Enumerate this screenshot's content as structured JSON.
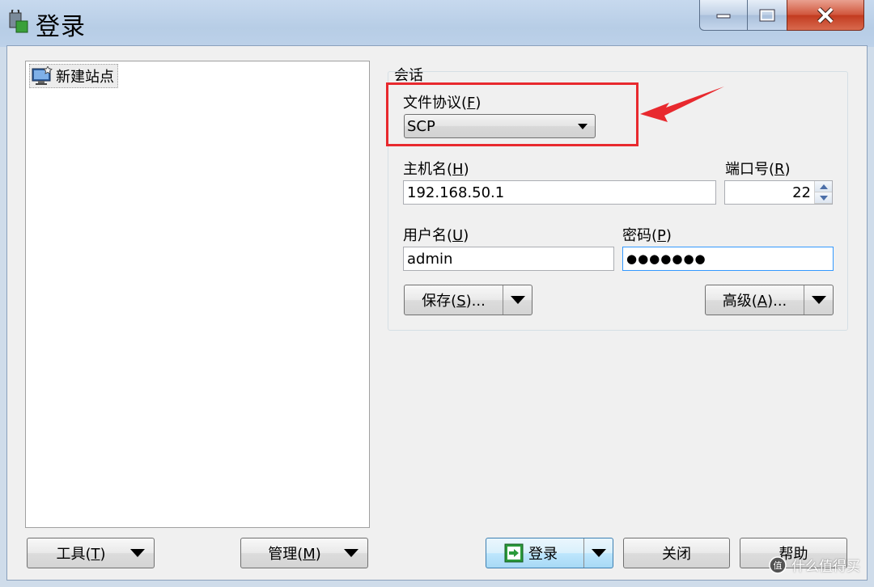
{
  "window": {
    "title": "登录",
    "minimize_icon": "minimize-icon",
    "maximize_icon": "maximize-icon",
    "close_icon": "close-icon"
  },
  "tree": {
    "items": [
      {
        "label": "新建站点",
        "icon": "monitor-new-site-icon"
      }
    ]
  },
  "session": {
    "group_label": "会话",
    "protocol_label": "文件协议",
    "protocol_key": "F",
    "protocol_value": "SCP",
    "host_label": "主机名",
    "host_key": "H",
    "host_value": "192.168.50.1",
    "port_label": "端口号",
    "port_key": "R",
    "port_value": "22",
    "user_label": "用户名",
    "user_key": "U",
    "user_value": "admin",
    "password_label": "密码",
    "password_key": "P",
    "password_value": "●●●●●●●",
    "save_label": "保存",
    "save_key": "S",
    "save_suffix": "...",
    "advanced_label": "高级",
    "advanced_key": "A",
    "advanced_suffix": "..."
  },
  "footer": {
    "tools_label": "工具",
    "tools_key": "T",
    "manage_label": "管理",
    "manage_key": "M",
    "login_label": "登录",
    "close_label": "关闭",
    "help_label": "帮助"
  },
  "annotation": {
    "color": "#e8292e"
  },
  "watermark": {
    "text": "什么值得买"
  }
}
